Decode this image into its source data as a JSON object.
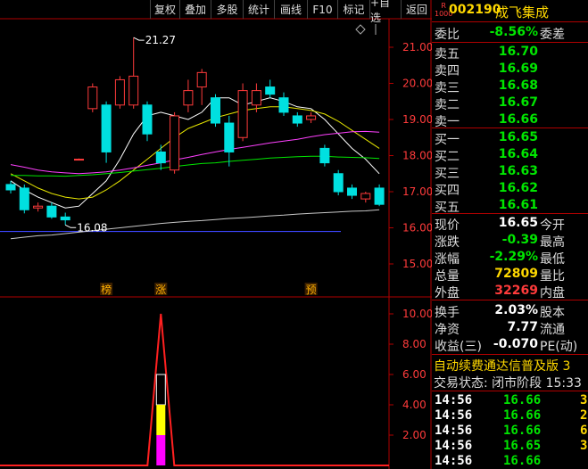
{
  "toolbar": {
    "items": [
      "复权",
      "叠加",
      "多股",
      "统计",
      "画线",
      "F10",
      "标记",
      "+自选",
      "返回"
    ]
  },
  "stock": {
    "badge_top": "R",
    "badge_bottom": "1000",
    "code": "002190",
    "name": "成飞集成"
  },
  "order_ratio": {
    "label": "委比",
    "value": "-8.56%",
    "diff_label": "委差"
  },
  "asks": [
    {
      "label": "卖五",
      "price": "16.70"
    },
    {
      "label": "卖四",
      "price": "16.69"
    },
    {
      "label": "卖三",
      "price": "16.68"
    },
    {
      "label": "卖二",
      "price": "16.67"
    },
    {
      "label": "卖一",
      "price": "16.66"
    }
  ],
  "bids": [
    {
      "label": "买一",
      "price": "16.65"
    },
    {
      "label": "买二",
      "price": "16.64"
    },
    {
      "label": "买三",
      "price": "16.63"
    },
    {
      "label": "买四",
      "price": "16.62"
    },
    {
      "label": "买五",
      "price": "16.61"
    }
  ],
  "quote": [
    {
      "label": "现价",
      "value": "16.65",
      "label2": "今开",
      "color": "#ffffff"
    },
    {
      "label": "涨跌",
      "value": "-0.39",
      "label2": "最高",
      "color": "#00e600"
    },
    {
      "label": "涨幅",
      "value": "-2.29%",
      "label2": "最低",
      "color": "#00e600"
    },
    {
      "label": "总量",
      "value": "72809",
      "label2": "量比",
      "color": "#ffd800"
    },
    {
      "label": "外盘",
      "value": "32269",
      "label2": "内盘",
      "color": "#ff3b3b"
    }
  ],
  "stats": [
    {
      "label": "换手",
      "value": "2.03%",
      "label2": "股本"
    },
    {
      "label": "净资",
      "value": "7.77",
      "label2": "流通"
    },
    {
      "label": "收益(三)",
      "value": "-0.070",
      "label2": "PE(动)"
    }
  ],
  "banner": "自动续费通达信普及版 3",
  "trade_status": "交易状态: 闭市阶段 15:33",
  "ticks": [
    {
      "time": "14:56",
      "price": "16.66",
      "vol": "3"
    },
    {
      "time": "14:56",
      "price": "16.66",
      "vol": "2"
    },
    {
      "time": "14:56",
      "price": "16.66",
      "vol": "6"
    },
    {
      "time": "14:56",
      "price": "16.65",
      "vol": "3"
    },
    {
      "time": "14:56",
      "price": "16.66",
      "vol": ""
    }
  ],
  "colors": {
    "up": "#ff3b3b",
    "down": "#00e0e0",
    "grid": "#b00000",
    "ma5": "#ffffff",
    "ma10": "#e6e600",
    "ma20": "#ff40ff",
    "ma60": "#00e600",
    "ma120": "#c8c8c8",
    "green_text": "#00e600",
    "yellow_text": "#ffd800",
    "signal_yellow": "#ffff00",
    "signal_magenta": "#ff00ff"
  },
  "chart_data": {
    "type": "candlestick",
    "y_axis_ticks": [
      "21.00",
      "20.00",
      "19.00",
      "18.00",
      "17.00",
      "16.00",
      "15.00"
    ],
    "ylim": [
      14.4,
      21.8
    ],
    "annotations": [
      {
        "text": "21.27",
        "value": 21.27,
        "index": 9
      },
      {
        "text": "16.08",
        "value": 16.08,
        "index": 4
      }
    ],
    "markers": [
      {
        "text": "榜",
        "index": 7
      },
      {
        "text": "涨",
        "index": 11
      },
      {
        "text": "预",
        "index": 22
      }
    ],
    "candles": [
      {
        "o": 17.2,
        "h": 17.3,
        "l": 16.95,
        "c": 17.05
      },
      {
        "o": 17.1,
        "h": 17.2,
        "l": 16.4,
        "c": 16.5
      },
      {
        "o": 16.55,
        "h": 16.7,
        "l": 16.45,
        "c": 16.6
      },
      {
        "o": 16.6,
        "h": 16.7,
        "l": 16.25,
        "c": 16.3
      },
      {
        "o": 16.3,
        "h": 16.42,
        "l": 16.08,
        "c": 16.22
      },
      {
        "o": 17.9,
        "h": 17.92,
        "l": 17.88,
        "c": 17.9
      },
      {
        "o": 19.3,
        "h": 20.0,
        "l": 19.2,
        "c": 19.9
      },
      {
        "o": 19.4,
        "h": 19.5,
        "l": 17.8,
        "c": 18.1
      },
      {
        "o": 19.4,
        "h": 20.2,
        "l": 19.3,
        "c": 20.1
      },
      {
        "o": 19.4,
        "h": 21.27,
        "l": 19.3,
        "c": 20.2
      },
      {
        "o": 19.4,
        "h": 19.5,
        "l": 18.4,
        "c": 18.6
      },
      {
        "o": 18.1,
        "h": 18.3,
        "l": 17.6,
        "c": 17.8
      },
      {
        "o": 17.6,
        "h": 19.2,
        "l": 17.5,
        "c": 19.1
      },
      {
        "o": 19.4,
        "h": 20.1,
        "l": 19.2,
        "c": 19.8
      },
      {
        "o": 19.9,
        "h": 20.4,
        "l": 19.4,
        "c": 20.3
      },
      {
        "o": 19.6,
        "h": 19.7,
        "l": 18.8,
        "c": 18.9
      },
      {
        "o": 18.9,
        "h": 19.1,
        "l": 17.7,
        "c": 18.1
      },
      {
        "o": 18.5,
        "h": 20.0,
        "l": 18.4,
        "c": 19.8
      },
      {
        "o": 19.4,
        "h": 20.0,
        "l": 19.2,
        "c": 19.8
      },
      {
        "o": 19.9,
        "h": 20.1,
        "l": 19.6,
        "c": 19.7
      },
      {
        "o": 19.6,
        "h": 19.75,
        "l": 19.1,
        "c": 19.2
      },
      {
        "o": 19.1,
        "h": 19.2,
        "l": 18.8,
        "c": 18.9
      },
      {
        "o": 19.0,
        "h": 19.2,
        "l": 18.9,
        "c": 19.1
      },
      {
        "o": 18.2,
        "h": 18.3,
        "l": 17.7,
        "c": 17.8
      },
      {
        "o": 17.5,
        "h": 17.6,
        "l": 16.9,
        "c": 17.0
      },
      {
        "o": 17.1,
        "h": 17.2,
        "l": 16.8,
        "c": 16.9
      },
      {
        "o": 16.8,
        "h": 17.0,
        "l": 16.7,
        "c": 16.95
      },
      {
        "o": 17.1,
        "h": 17.2,
        "l": 16.6,
        "c": 16.65
      }
    ],
    "ma_series": [
      {
        "key": "ma5",
        "values": [
          17.3,
          17.05,
          16.85,
          16.7,
          16.55,
          16.6,
          16.95,
          17.3,
          17.9,
          18.6,
          19.1,
          19.2,
          19.1,
          19.0,
          19.2,
          19.6,
          19.6,
          19.4,
          19.5,
          19.6,
          19.5,
          19.35,
          19.3,
          19.0,
          18.6,
          18.2,
          17.9,
          17.5
        ]
      },
      {
        "key": "ma10",
        "values": [
          17.5,
          17.3,
          17.1,
          16.95,
          16.85,
          16.8,
          16.85,
          17.05,
          17.3,
          17.6,
          17.9,
          18.2,
          18.5,
          18.75,
          18.9,
          19.05,
          19.15,
          19.25,
          19.3,
          19.35,
          19.35,
          19.3,
          19.25,
          19.15,
          18.95,
          18.7,
          18.45,
          18.2
        ]
      },
      {
        "key": "ma20",
        "values": [
          17.75,
          17.68,
          17.6,
          17.55,
          17.52,
          17.5,
          17.52,
          17.55,
          17.6,
          17.66,
          17.73,
          17.8,
          17.88,
          17.95,
          18.03,
          18.1,
          18.17,
          18.23,
          18.29,
          18.35,
          18.4,
          18.45,
          18.52,
          18.58,
          18.62,
          18.66,
          18.67,
          18.65
        ]
      },
      {
        "key": "ma60",
        "values": [
          17.45,
          17.45,
          17.44,
          17.44,
          17.43,
          17.45,
          17.47,
          17.5,
          17.53,
          17.57,
          17.61,
          17.65,
          17.7,
          17.74,
          17.78,
          17.8,
          17.84,
          17.87,
          17.9,
          17.93,
          17.95,
          17.97,
          17.98,
          17.98,
          17.96,
          17.95,
          17.94,
          17.92
        ]
      },
      {
        "key": "ma120",
        "values": [
          15.7,
          15.74,
          15.78,
          15.8,
          15.84,
          15.88,
          15.92,
          15.96,
          16.0,
          16.04,
          16.08,
          16.12,
          16.15,
          16.18,
          16.2,
          16.23,
          16.26,
          16.28,
          16.3,
          16.33,
          16.35,
          16.38,
          16.4,
          16.42,
          16.44,
          16.46,
          16.47,
          16.5
        ]
      }
    ],
    "flat_line": {
      "key": "blue",
      "value": 15.9
    },
    "sub_y_axis_ticks": [
      "10.00",
      "8.00",
      "6.00",
      "4.00",
      "2.00"
    ],
    "sub_ylim": [
      0,
      11.7
    ],
    "signal": {
      "baseline": 0,
      "peak_index": 11,
      "peak_value": 10.0,
      "bar_yellow": [
        2.0,
        4.0
      ],
      "bar_magenta": [
        0,
        2.0
      ],
      "bar_outline_top": 6.0
    }
  }
}
